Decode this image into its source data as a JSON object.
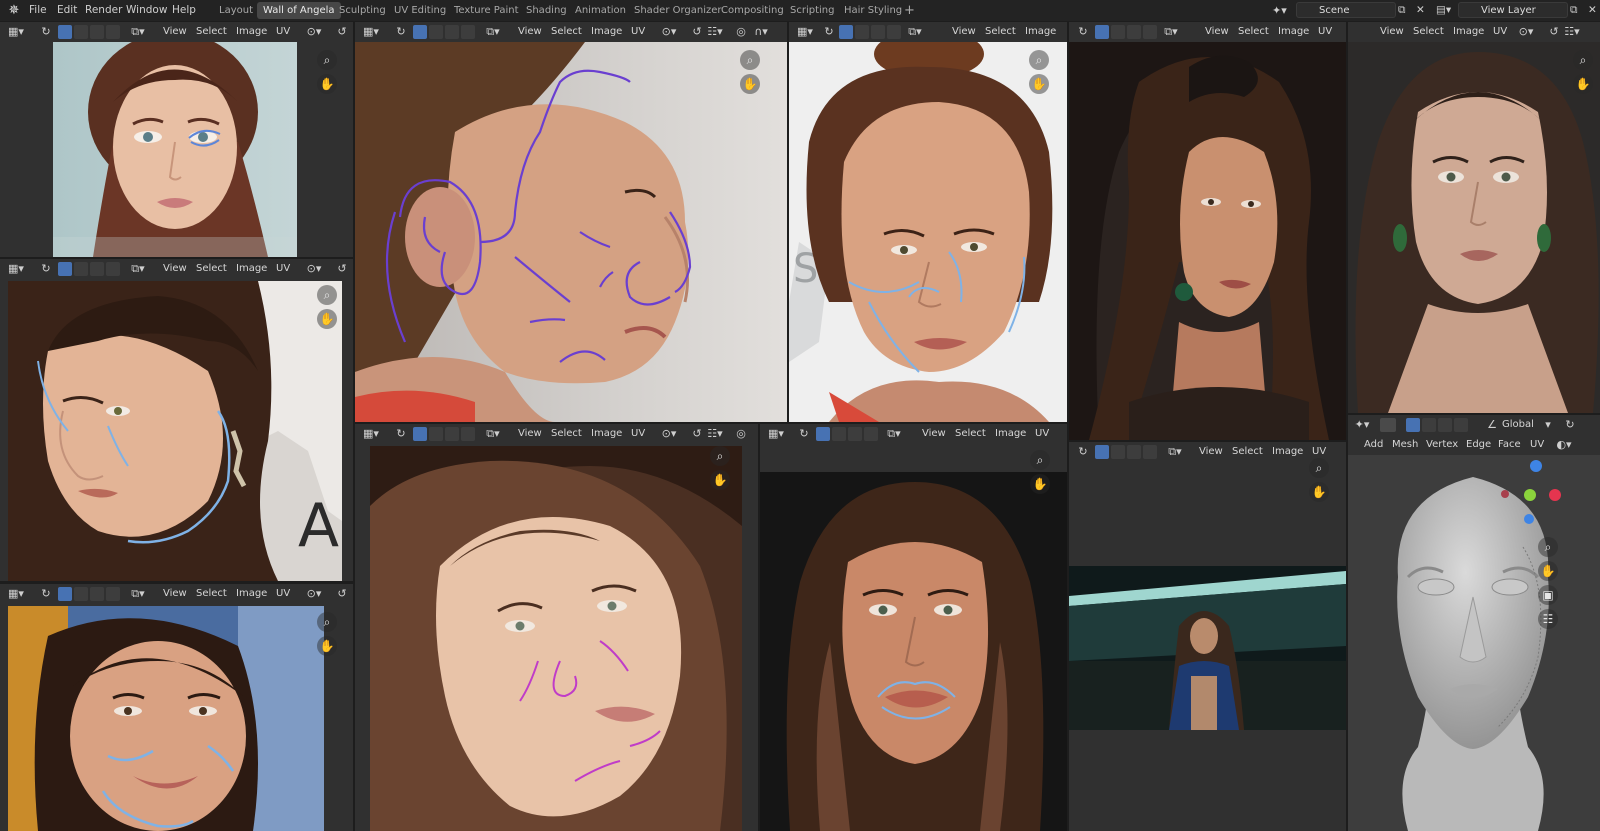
{
  "menubar": {
    "app_icon": "blender-logo-icon",
    "file": "File",
    "edit": "Edit",
    "render": "Render",
    "window": "Window",
    "help": "Help"
  },
  "workspaces": [
    {
      "label": "Layout",
      "active": false
    },
    {
      "label": "Wall of Angela",
      "active": true
    },
    {
      "label": "Sculpting",
      "active": false
    },
    {
      "label": "UV Editing",
      "active": false
    },
    {
      "label": "Texture Paint",
      "active": false
    },
    {
      "label": "Shading",
      "active": false
    },
    {
      "label": "Animation",
      "active": false
    },
    {
      "label": "Shader Organizer",
      "active": false
    },
    {
      "label": "Compositing",
      "active": false
    },
    {
      "label": "Scripting",
      "active": false
    },
    {
      "label": "Hair Styling",
      "active": false
    }
  ],
  "add_workspace": "+",
  "scene": {
    "label": "Scene"
  },
  "view_layer": {
    "label": "View Layer"
  },
  "image_editor_menu": {
    "view": "View",
    "select": "Select",
    "image": "Image",
    "uv": "UV"
  },
  "viewport_menu": {
    "add": "Add",
    "mesh": "Mesh",
    "vertex": "Vertex",
    "edge": "Edge",
    "face": "Face",
    "uv": "UV",
    "transform_orientation": "Global"
  },
  "colors": {
    "accent_blue": "#4772b3",
    "header_bg": "#303030",
    "topbar_bg": "#232323",
    "sketch_purple": "#6a3fd0",
    "sketch_blue": "#7fb2e6",
    "sketch_magenta": "#c03cc8",
    "gizmo_x": "#e5354f",
    "gizmo_y": "#8bd33c",
    "gizmo_z": "#3e84e5"
  }
}
